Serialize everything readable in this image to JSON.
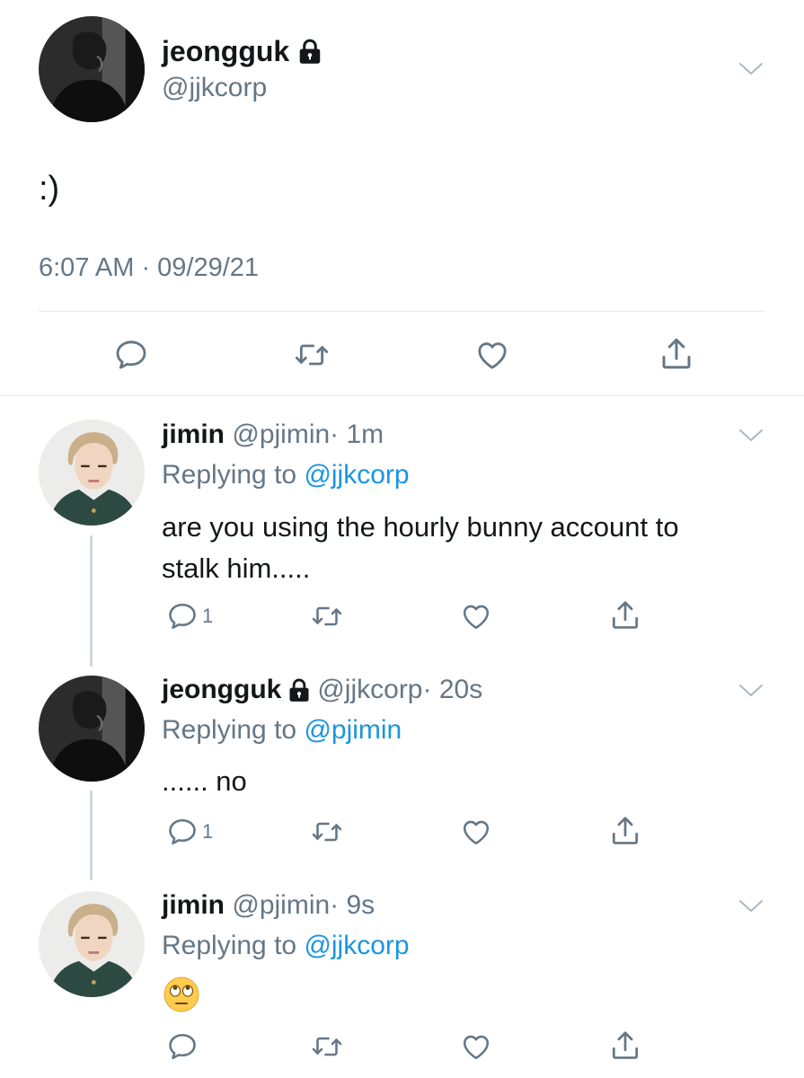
{
  "main_tweet": {
    "display_name": "jeongguk",
    "handle": "@jjkcorp",
    "text": ":)",
    "timestamp": "6:07 AM · 09/29/21",
    "avatar_icon": "profile-photo-dark",
    "lock_icon": "lock-icon",
    "actions": [
      "reply-icon",
      "retweet-icon",
      "like-icon",
      "share-icon"
    ]
  },
  "replies": [
    {
      "display_name": "jimin",
      "handle": "@pjimin",
      "time": "· 1m",
      "replying_prefix": "Replying to",
      "replying_to": "@jjkcorp",
      "text_line1": "are you using the hourly bunny account to",
      "text_line2": "stalk him.....",
      "reply_count": "1"
    },
    {
      "display_name": "jeongguk",
      "handle": "@jjkcorp",
      "time": "· 20s",
      "replying_prefix": "Replying to",
      "replying_to": "@pjimin",
      "text": "...... no",
      "reply_count": "1"
    },
    {
      "display_name": "jimin",
      "handle": "@pjimin",
      "time": "· 9s",
      "replying_prefix": "Replying to",
      "replying_to": "@jjkcorp",
      "emoji": "🙄",
      "emoji_icon": "face-with-rolling-eyes-emoji"
    }
  ],
  "colors": {
    "text": "#14171a",
    "muted": "#657786",
    "link": "#1b95e0",
    "divider": "#e1e8ed",
    "thread_line": "#ccd6dd"
  }
}
